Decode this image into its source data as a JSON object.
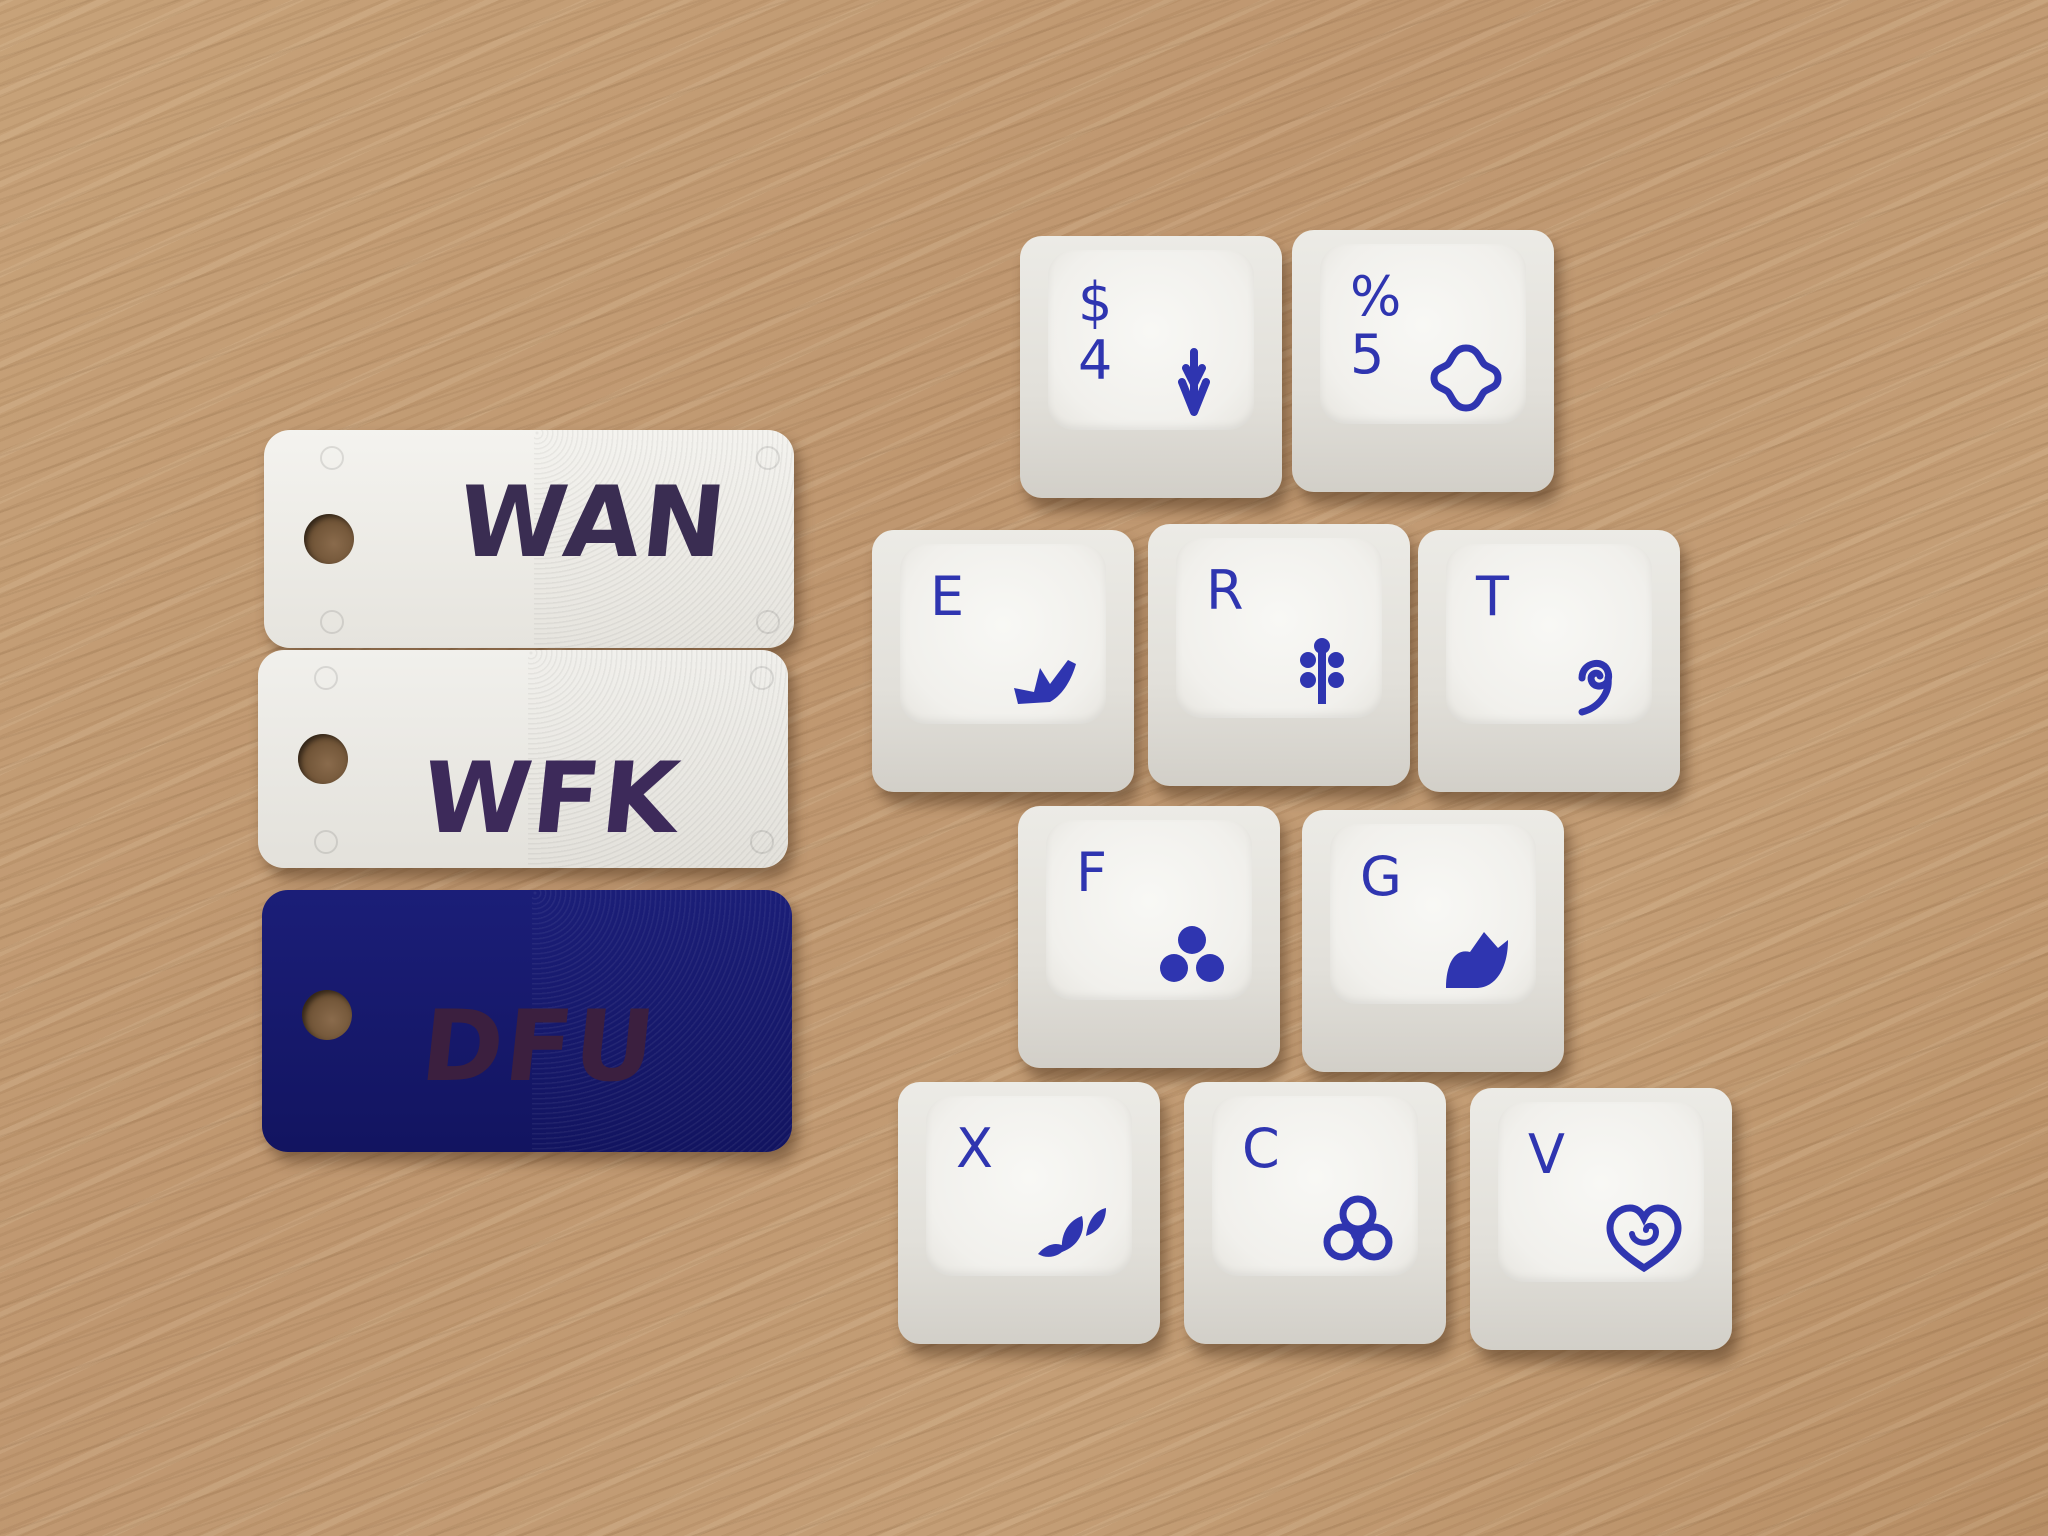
{
  "tags": [
    {
      "label": "WAN"
    },
    {
      "label": "WFK"
    },
    {
      "label": "DFU"
    }
  ],
  "keys": [
    {
      "id": "key-4",
      "primary": "$",
      "secondary": "4",
      "icon": "arrow-sprout-icon"
    },
    {
      "id": "key-5",
      "primary": "%",
      "secondary": "5",
      "icon": "quatrefoil-icon"
    },
    {
      "id": "key-e",
      "primary": "E",
      "icon": "tulip-icon"
    },
    {
      "id": "key-r",
      "primary": "R",
      "icon": "flower-branch-icon"
    },
    {
      "id": "key-t",
      "primary": "T",
      "icon": "fern-curl-icon"
    },
    {
      "id": "key-f",
      "primary": "F",
      "icon": "three-dots-icon"
    },
    {
      "id": "key-g",
      "primary": "G",
      "icon": "leaf-icon"
    },
    {
      "id": "key-x",
      "primary": "X",
      "icon": "leaves-icon"
    },
    {
      "id": "key-c",
      "primary": "C",
      "icon": "trefoil-icon"
    },
    {
      "id": "key-v",
      "primary": "V",
      "icon": "heart-swirl-icon"
    }
  ],
  "colors": {
    "legend": "#2f35b0",
    "navy_tag": "#1b1e78",
    "wood": "#c19a72"
  }
}
